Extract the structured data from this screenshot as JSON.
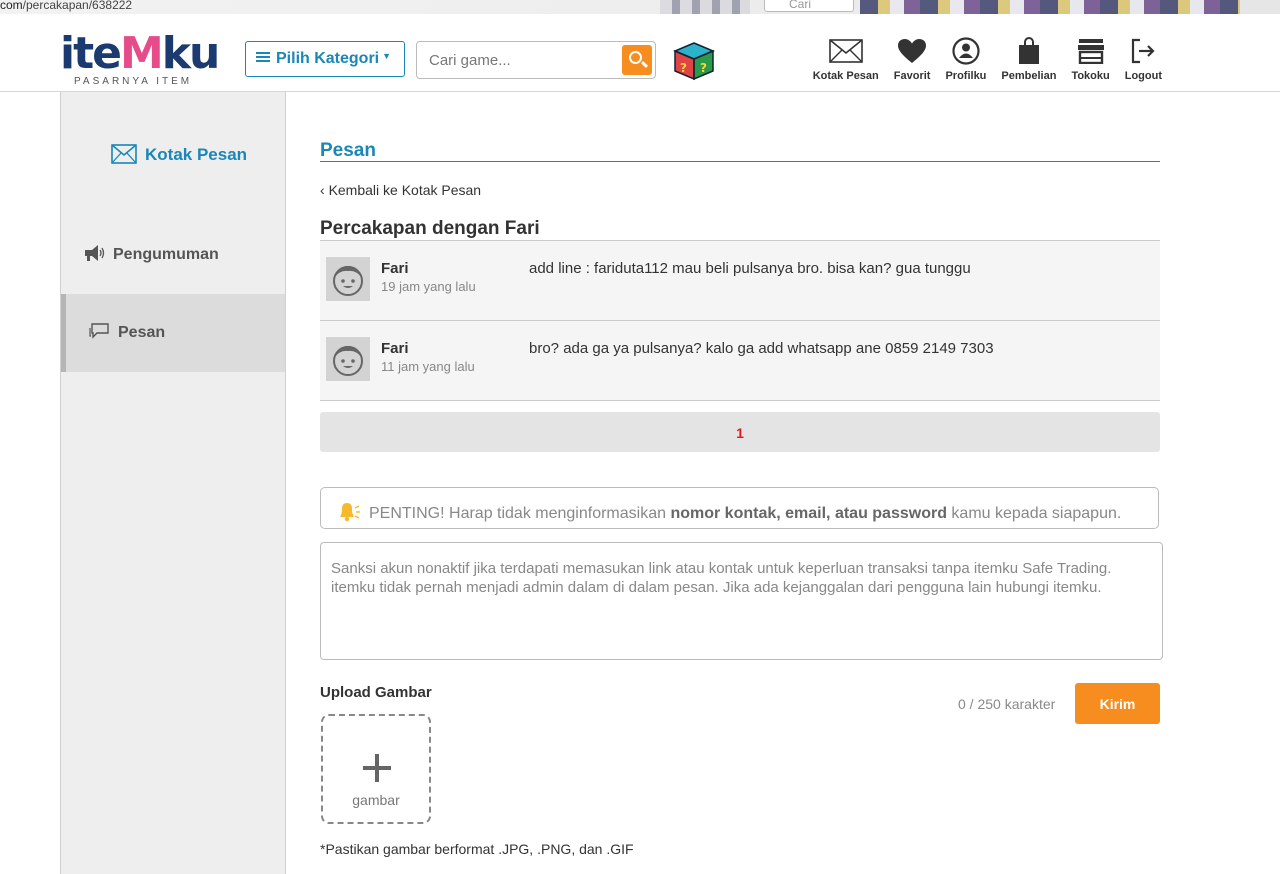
{
  "browser": {
    "url_prefix": "com",
    "url_path": "/percakapan/638222",
    "search_placeholder": "Cari"
  },
  "logo": {
    "word_a": "ite",
    "word_m": "M",
    "word_b": "ku",
    "tagline": "PASARNYA ITEM"
  },
  "header": {
    "category_label": "Pilih Kategori",
    "search_placeholder": "Cari game...",
    "nav": [
      {
        "label": "Kotak Pesan",
        "icon": "envelope-icon"
      },
      {
        "label": "Favorit",
        "icon": "heart-icon"
      },
      {
        "label": "Profilku",
        "icon": "user-icon"
      },
      {
        "label": "Pembelian",
        "icon": "shopping-bag-icon"
      },
      {
        "label": "Tokoku",
        "icon": "store-icon"
      },
      {
        "label": "Logout",
        "icon": "logout-icon"
      }
    ]
  },
  "sidebar": {
    "title": "Kotak Pesan",
    "items": [
      {
        "label": "Pengumuman",
        "icon": "megaphone-icon",
        "active": false
      },
      {
        "label": "Pesan",
        "icon": "chat-icon",
        "active": true
      }
    ]
  },
  "main": {
    "section_title": "Pesan",
    "back_label": "Kembali ke Kotak Pesan",
    "conversation_title": "Percakapan dengan Fari",
    "messages": [
      {
        "sender": "Fari",
        "time": "19 jam yang lalu",
        "text": "add line : fariduta112 mau beli pulsanya bro. bisa kan? gua tunggu"
      },
      {
        "sender": "Fari",
        "time": "11 jam yang lalu",
        "text": "bro? ada ga ya pulsanya? kalo ga add whatsapp ane 0859 2149 7303"
      }
    ],
    "current_page": "1",
    "warning": {
      "prefix": "PENTING! Harap tidak menginformasikan",
      "bold": "nomor kontak, email, atau password",
      "suffix": "kamu kepada siapapun."
    },
    "textarea_placeholder": "Sanksi akun nonaktif jika terdapati memasukan link atau kontak untuk keperluan transaksi tanpa itemku Safe Trading. itemku tidak pernah menjadi admin dalam di dalam pesan. Jika ada kejanggalan dari pengguna lain hubungi itemku.",
    "upload_label": "Upload Gambar",
    "char_count": "0 / 250 karakter",
    "send_label": "Kirim",
    "upload_caption": "gambar",
    "format_note": "*Pastikan gambar berformat .JPG, .PNG, dan .GIF"
  },
  "colors": {
    "brand_blue": "#1a87b8",
    "accent_orange": "#f78d1e",
    "page_red": "#e01b1b"
  }
}
